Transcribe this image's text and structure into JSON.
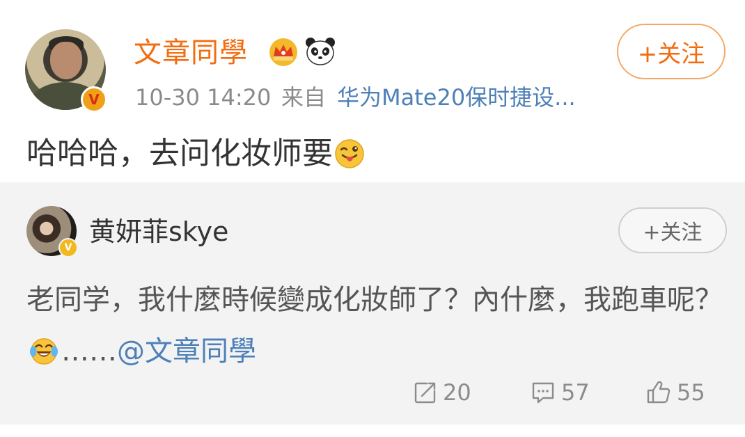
{
  "post": {
    "author": "文章同學",
    "time": "10-30 14:20",
    "from_label": "来自",
    "device": "华为Mate20保时捷设...",
    "follow_label": "+关注",
    "text": "哈哈哈，去问化妆师要",
    "emoji": "tongue-emoji"
  },
  "repost": {
    "author": "黄妍菲skye",
    "follow_label": "+关注",
    "text_before": "老同学，我什麼時候變成化妝師了？內什麼，我跑車呢？",
    "text_after": "……",
    "mention": "@文章同學",
    "emoji": "laugh-cry-emoji"
  },
  "actions": {
    "reposts": "20",
    "comments": "57",
    "likes": "55"
  },
  "colors": {
    "accent": "#f26d10",
    "link": "#4e80b8",
    "muted": "#8a8a8a",
    "repost_bg": "#f3f3f3"
  }
}
